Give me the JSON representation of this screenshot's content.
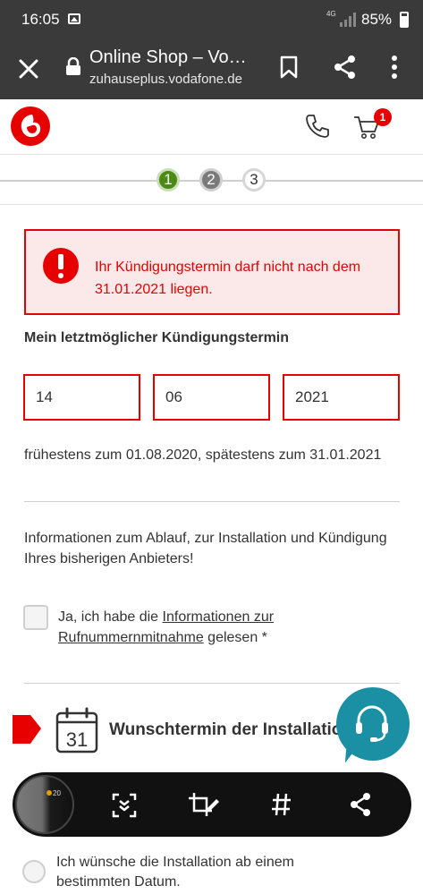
{
  "status_bar": {
    "time": "16:05",
    "network": "4G",
    "battery": "85%"
  },
  "browser": {
    "title": "Online Shop – Vo…",
    "url": "zuhauseplus.vodafone.de"
  },
  "header": {
    "cart_count": "1"
  },
  "steps": [
    "1",
    "2",
    "3"
  ],
  "error": {
    "message": "Ihr Kündigungstermin darf nicht nach dem 31.01.2021 liegen."
  },
  "form": {
    "deadline_label": "Mein letztmöglicher Kündigungstermin",
    "day": "14",
    "month": "06",
    "year": "2021",
    "range_hint": "frühestens zum 01.08.2020, spätestens zum 31.01.2021"
  },
  "info": {
    "text": "Informationen zum Ablauf, zur Installation und Kündigung Ihres bisherigen Anbieters!"
  },
  "consent": {
    "prefix": "Ja, ich habe die ",
    "link": "Informationen zur Rufnummernmitnahme",
    "suffix": " gelesen *"
  },
  "installation": {
    "calendar_day": "31",
    "heading": "Wunschtermin der Installation",
    "radio_label": "Ich wünsche die Installation ab einem bestimmten Datum."
  },
  "capture_toolbar": {
    "thumb_time": "20"
  },
  "colors": {
    "accent": "#e60000",
    "chat": "#1b8fa4",
    "step_done": "#4a8a15"
  }
}
